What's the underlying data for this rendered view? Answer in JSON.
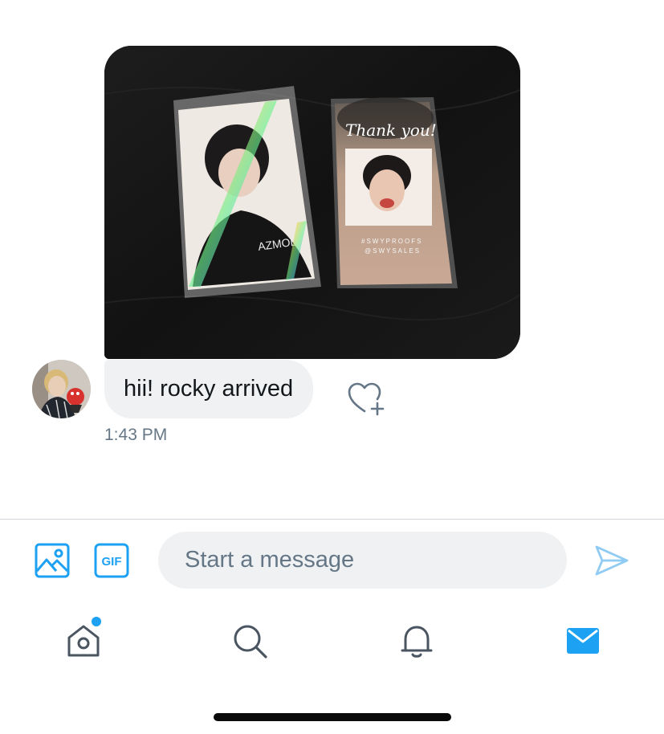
{
  "conversation": {
    "messages": [
      {
        "text": "hii! rocky arrived",
        "time": "1:43 PM"
      }
    ],
    "photo": {
      "card_text": {
        "thank_you": "Thank you!",
        "line1": "#SWYPROOFS",
        "line2": "@SWYSALES"
      }
    }
  },
  "composer": {
    "placeholder": "Start a message",
    "gif_label": "GIF",
    "icons": {
      "image": "image-icon",
      "gif": "gif-icon",
      "send": "send-icon"
    }
  },
  "tab_bar": {
    "icons": [
      "home-icon",
      "search-icon",
      "bell-icon",
      "mail-icon"
    ],
    "active": "mail-icon",
    "home_has_badge": true
  },
  "colors": {
    "accent": "#1da1f2",
    "bubble": "#eff1f3",
    "secondary_text": "#657786",
    "icon_gray": "#657786"
  }
}
